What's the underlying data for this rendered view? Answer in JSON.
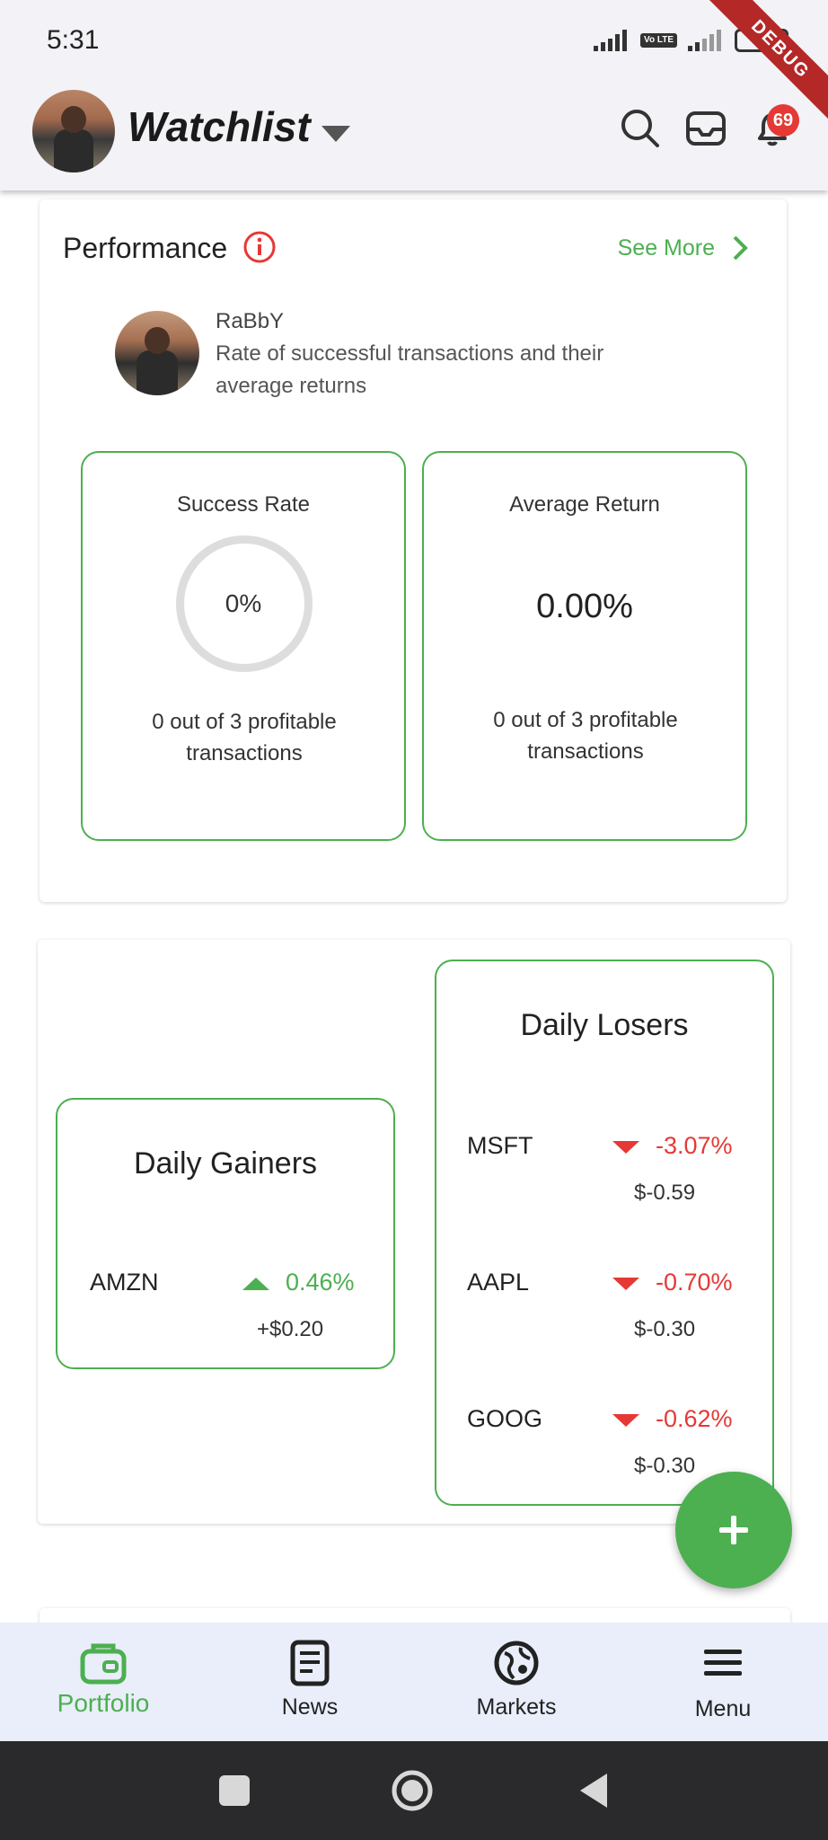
{
  "status_bar": {
    "time": "5:31",
    "volte": "Vo LTE",
    "battery": "80",
    "debug_ribbon": "DEBUG"
  },
  "app_bar": {
    "title": "Watchlist",
    "notification_count": "69",
    "icons": [
      "search-icon",
      "inbox-icon",
      "bell-icon",
      "chevron-down-icon"
    ]
  },
  "performance": {
    "title": "Performance",
    "see_more": "See More",
    "user_name": "RaBbY",
    "description": "Rate of successful transactions and their average returns",
    "success_rate": {
      "label": "Success Rate",
      "value": "0%",
      "fraction": 0,
      "subtext": "0 out of 3 profitable transactions"
    },
    "average_return": {
      "label": "Average Return",
      "value": "0.00%",
      "subtext": "0 out of 3 profitable transactions"
    }
  },
  "movers": {
    "gainers": {
      "title": "Daily Gainers",
      "items": [
        {
          "symbol": "AMZN",
          "pct": "0.46%",
          "amount": "+$0.20"
        }
      ]
    },
    "losers": {
      "title": "Daily Losers",
      "items": [
        {
          "symbol": "MSFT",
          "pct": "-3.07%",
          "amount": "$-0.59"
        },
        {
          "symbol": "AAPL",
          "pct": "-0.70%",
          "amount": "$-0.30"
        },
        {
          "symbol": "GOOG",
          "pct": "-0.62%",
          "amount": "$-0.30"
        }
      ]
    }
  },
  "fab": {
    "icon": "plus-icon"
  },
  "bottom_nav": {
    "items": [
      {
        "label": "Portfolio",
        "icon": "wallet-icon",
        "active": true
      },
      {
        "label": "News",
        "icon": "news-icon",
        "active": false
      },
      {
        "label": "Markets",
        "icon": "globe-icon",
        "active": false
      },
      {
        "label": "Menu",
        "icon": "menu-icon",
        "active": false
      }
    ]
  },
  "colors": {
    "accent_green": "#4caf50",
    "loss_red": "#e53935",
    "app_bar_bg": "#f2f2f7",
    "nav_bg": "#e9eefa"
  }
}
